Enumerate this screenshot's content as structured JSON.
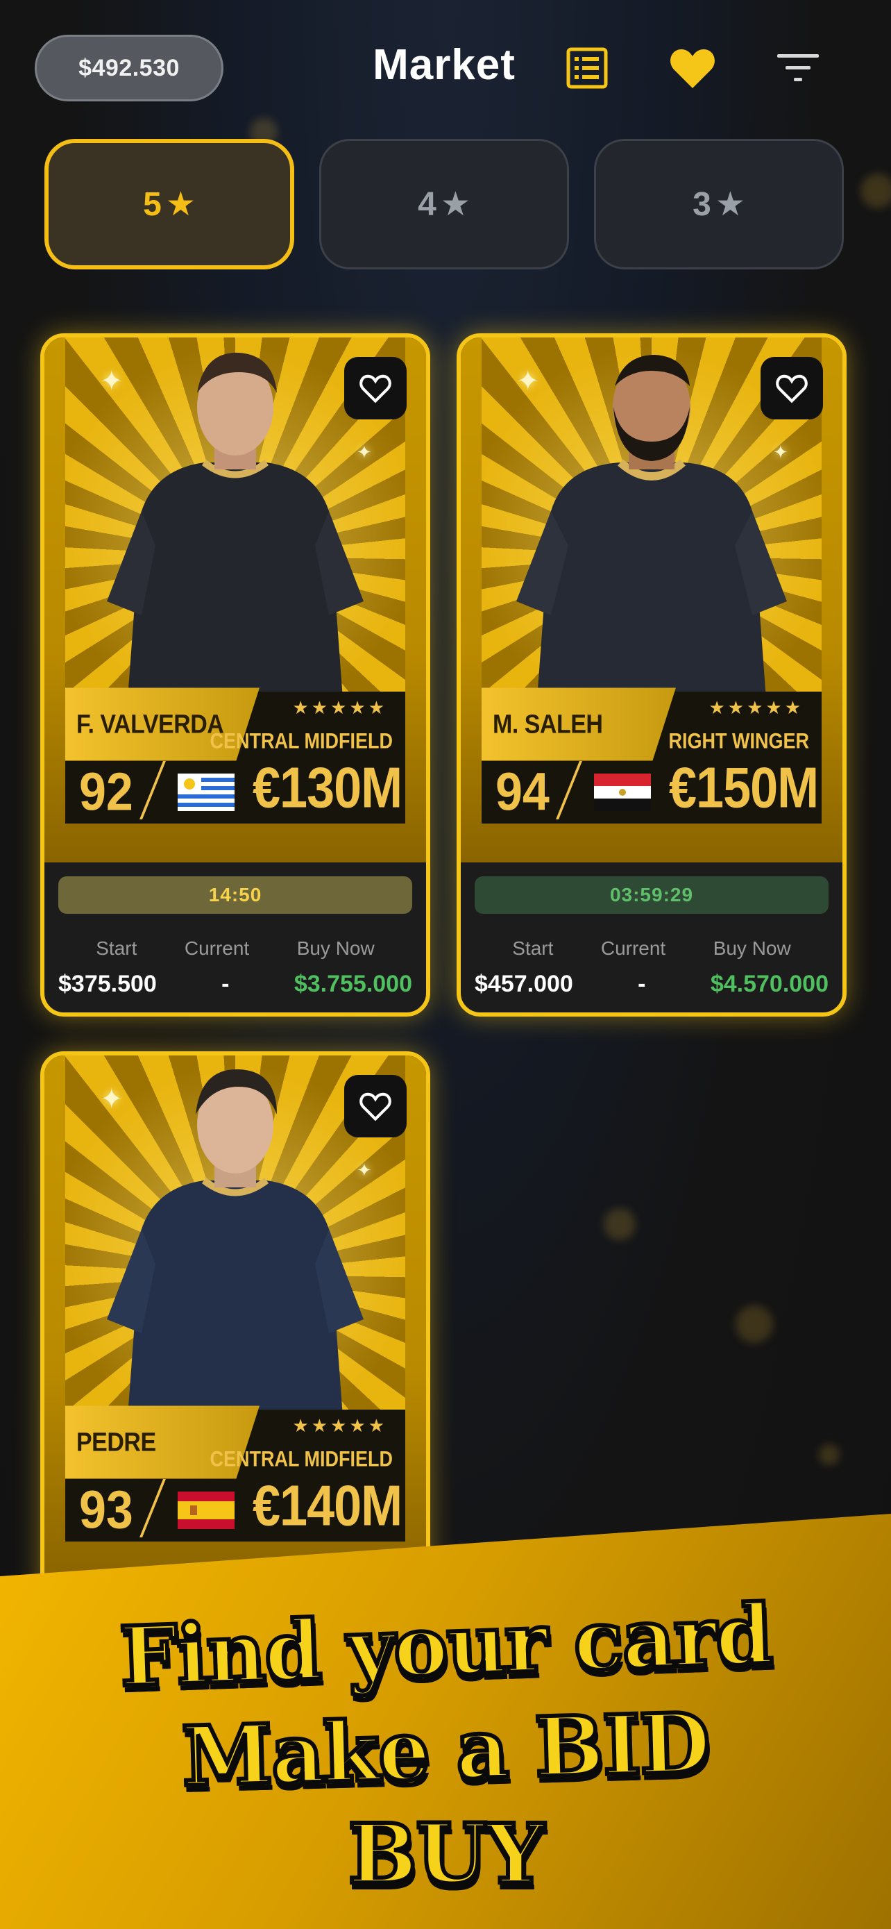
{
  "header": {
    "balance": "$492.530",
    "title": "Market",
    "icons": {
      "list": "list-icon",
      "favorites": "heart-icon",
      "filter": "filter-icon"
    }
  },
  "tabs": [
    {
      "label": "5",
      "icon": "star-icon",
      "active": true
    },
    {
      "label": "4",
      "icon": "star-icon",
      "active": false
    },
    {
      "label": "3",
      "icon": "star-icon",
      "active": false
    }
  ],
  "cards": [
    {
      "name": "F. VALVERDA",
      "stars": "★★★★★",
      "position": "CENTRAL MIDFIELD",
      "rating": "92",
      "flag": "uruguay-flag",
      "price": "€130M",
      "timer": "14:50",
      "labels": {
        "start": "Start",
        "current": "Current",
        "buy_now": "Buy Now"
      },
      "values": {
        "start": "$375.500",
        "current": "-",
        "buy_now": "$3.755.000"
      }
    },
    {
      "name": "M. SALEH",
      "stars": "★★★★★",
      "position": "RIGHT WINGER",
      "rating": "94",
      "flag": "egypt-flag",
      "price": "€150M",
      "timer": "03:59:29",
      "labels": {
        "start": "Start",
        "current": "Current",
        "buy_now": "Buy Now"
      },
      "values": {
        "start": "$457.000",
        "current": "-",
        "buy_now": "$4.570.000"
      }
    },
    {
      "name": "PEDRE",
      "stars": "★★★★★",
      "position": "CENTRAL MIDFIELD",
      "rating": "93",
      "flag": "spain-flag",
      "price": "€140M"
    }
  ],
  "promo": {
    "line1": "Find your card",
    "line2": "Make a BID",
    "line3": "BUY"
  },
  "colors": {
    "accent": "#f5be16",
    "buy_green": "#4fbf5f",
    "timer_gold_bg": "#6d6739",
    "timer_green_bg": "#2e4a34"
  }
}
